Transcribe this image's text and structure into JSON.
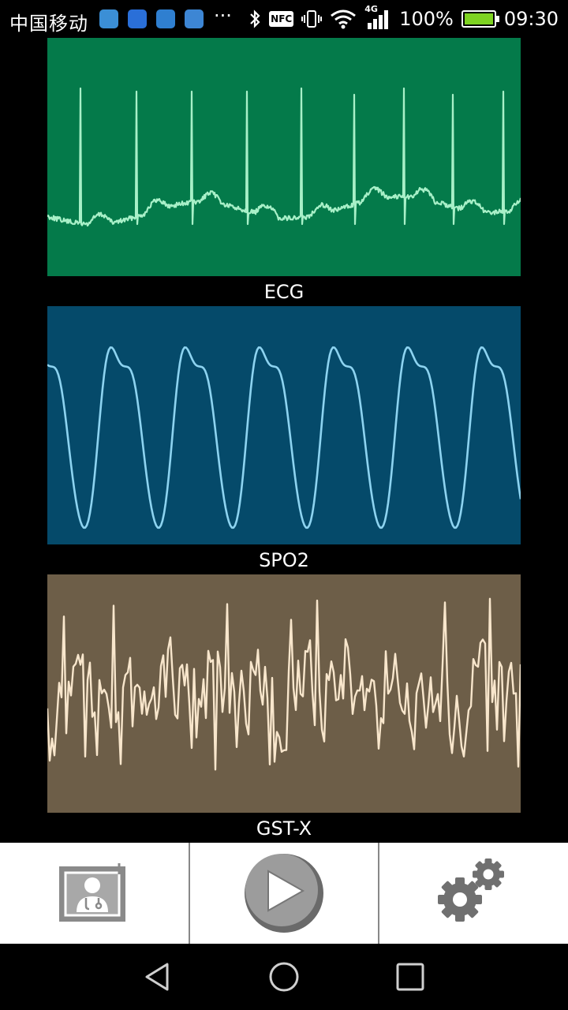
{
  "status_bar": {
    "carrier": "中国移动",
    "more": "···",
    "nfc": "NFC",
    "network": "4G",
    "battery": "100%",
    "time": "09:30"
  },
  "panels": {
    "ecg": {
      "label": "ECG",
      "background": "#047a4a",
      "trace_color": "#a8f0c8"
    },
    "spo2": {
      "label": "SPO2",
      "background": "#054a6a",
      "trace_color": "#8dd3f0"
    },
    "gst": {
      "label": "GST-X",
      "background": "#6d5e48",
      "trace_color": "#f8e6cc"
    }
  },
  "toolbar": {
    "icons": [
      "add-doctor-icon",
      "play-icon",
      "gears-icon"
    ]
  },
  "nav_bar": {
    "icons": [
      "back-icon",
      "home-icon",
      "recents-icon"
    ]
  }
}
